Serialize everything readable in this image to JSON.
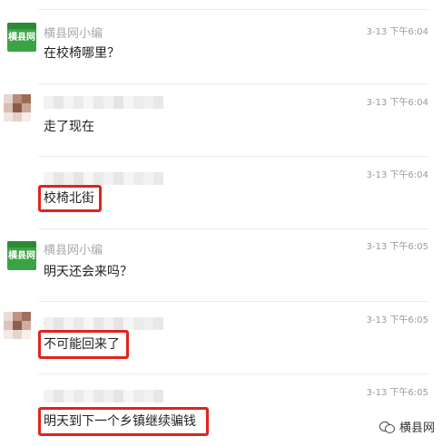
{
  "colors": {
    "highlight": "#e0231d",
    "logo_green": "#3aa346"
  },
  "messages": [
    {
      "sender": "横县网小编",
      "time": "3-13 下午6:04",
      "text": "在校椅哪里？",
      "avatar": "logo",
      "highlighted": false
    },
    {
      "sender": "",
      "time": "3-13 下午6:04",
      "text": "走了现在",
      "avatar": "blurred",
      "highlighted": false
    },
    {
      "sender": "",
      "time": "3-13 下午6:04",
      "text": "校椅北街",
      "avatar": "none",
      "highlighted": true
    },
    {
      "sender": "横县网小编",
      "time": "3-13 下午6:05",
      "text": "明天还会来吗？",
      "avatar": "logo",
      "highlighted": false
    },
    {
      "sender": "",
      "time": "3-13 下午6:05",
      "text": "不可能回来了",
      "avatar": "blurred",
      "highlighted": true
    },
    {
      "sender": "",
      "time": "3-13 下午6:05",
      "text": "明天到下一个乡镇继续骗钱",
      "avatar": "none",
      "highlighted": true
    }
  ],
  "logo": {
    "text": "横县网"
  },
  "watermark": {
    "icon": "wechat-icon",
    "text": "横县网"
  }
}
